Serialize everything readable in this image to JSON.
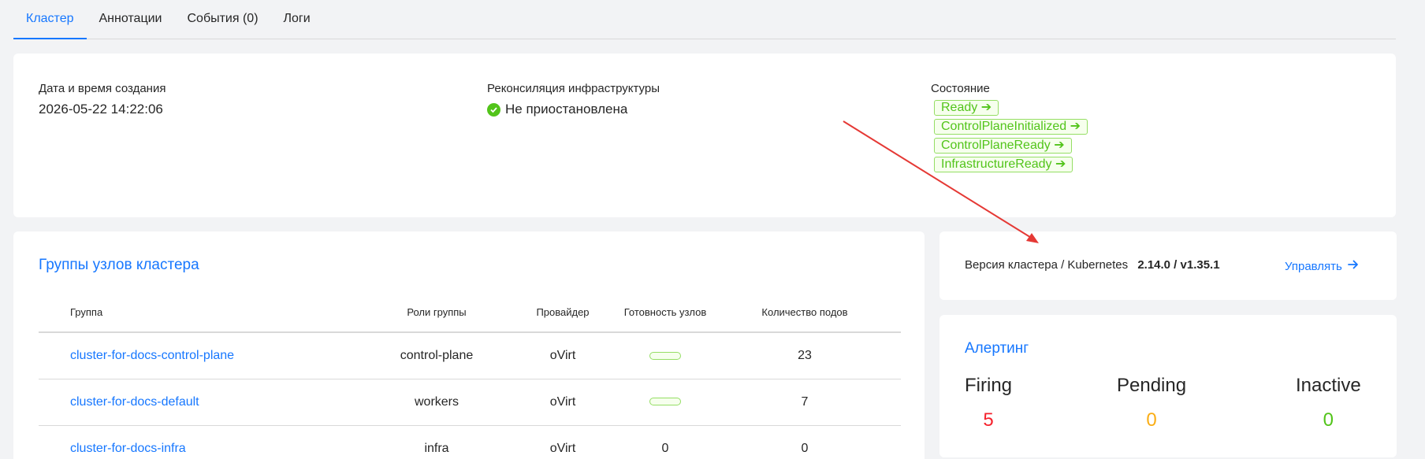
{
  "tabs": [
    {
      "label": "Кластер"
    },
    {
      "label": "Аннотации"
    },
    {
      "label": "События (0)"
    },
    {
      "label": "Логи"
    }
  ],
  "info": {
    "created_label": "Дата и время создания",
    "created_value": "2026-05-22 14:22:06",
    "reconcile_label": "Реконсиляция инфраструктуры",
    "reconcile_value": "Не приостановлена",
    "state_label": "Состояние",
    "states": [
      {
        "label": "Ready"
      },
      {
        "label": "ControlPlaneInitialized"
      },
      {
        "label": "ControlPlaneReady"
      },
      {
        "label": "InfrastructureReady"
      }
    ]
  },
  "groups": {
    "title": "Группы узлов кластера",
    "columns": [
      "Группа",
      "Роли группы",
      "Провайдер",
      "Готовность узлов",
      "Количество подов"
    ],
    "rows": [
      {
        "name": "cluster-for-docs-control-plane",
        "role": "control-plane",
        "provider": "oVirt",
        "ready": "",
        "pods": "23"
      },
      {
        "name": "cluster-for-docs-default",
        "role": "workers",
        "provider": "oVirt",
        "ready": "",
        "pods": "7"
      },
      {
        "name": "cluster-for-docs-infra",
        "role": "infra",
        "provider": "oVirt",
        "ready": "0",
        "pods": "0"
      }
    ]
  },
  "version": {
    "label": "Версия кластера / Kubernetes",
    "value": "2.14.0 / v1.35.1",
    "manage_label": "Управлять"
  },
  "alerting": {
    "title": "Алертинг",
    "firing_label": "Firing",
    "firing_value": "5",
    "pending_label": "Pending",
    "pending_value": "0",
    "inactive_label": "Inactive",
    "inactive_value": "0"
  },
  "colors": {
    "accent": "#1677ff",
    "success": "#52c41a",
    "danger": "#f5222d",
    "warning": "#faad14",
    "annotation_arrow": "#e53935"
  }
}
